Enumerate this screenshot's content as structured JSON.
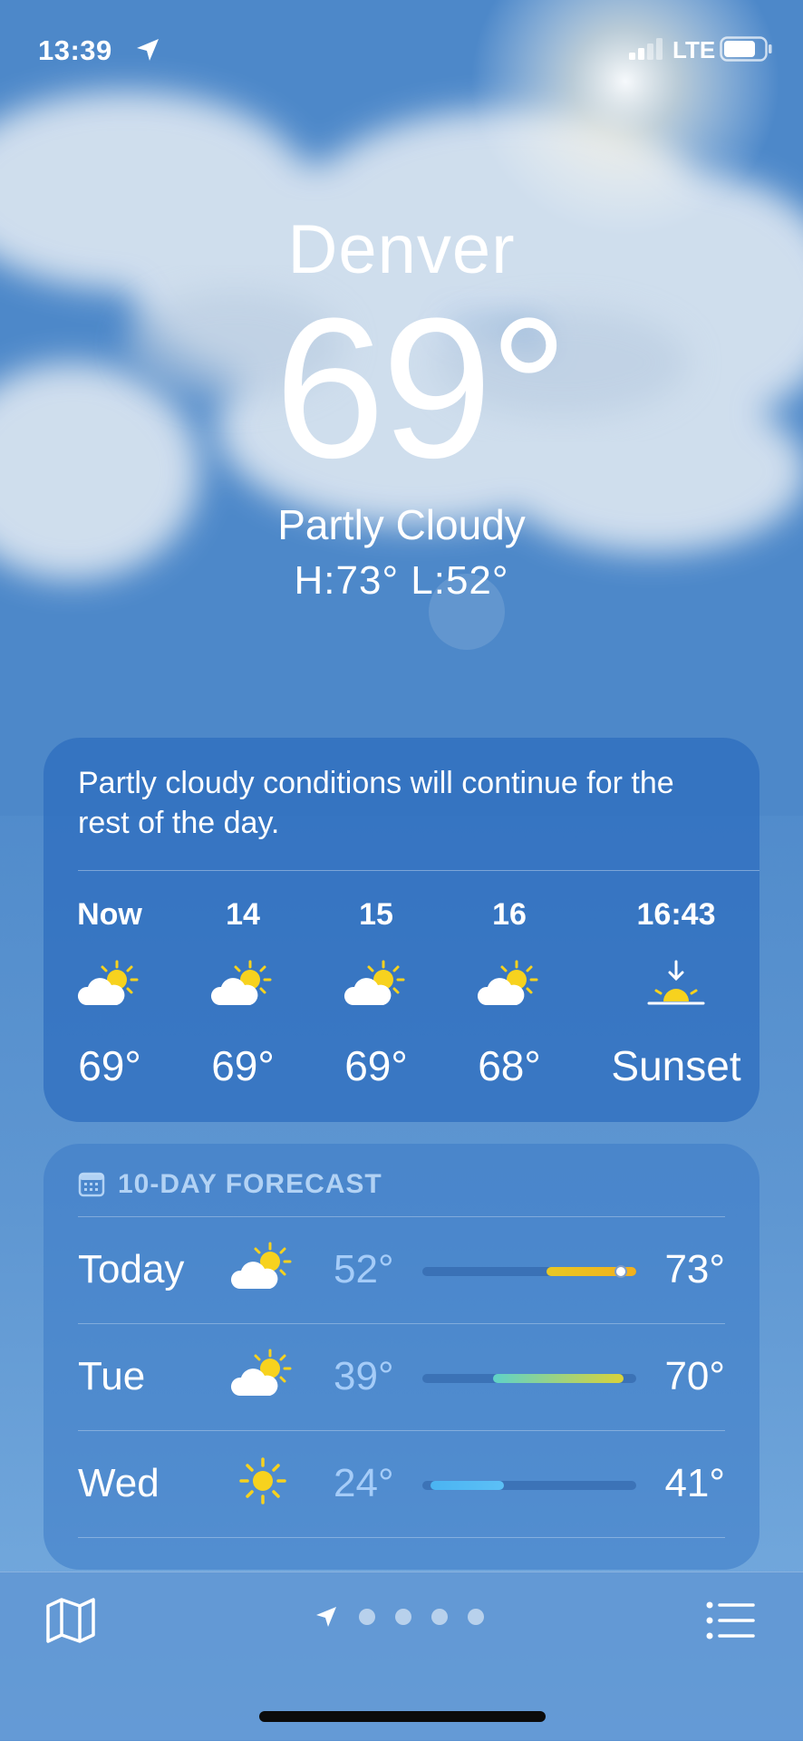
{
  "status_bar": {
    "time": "13:39",
    "network": "LTE"
  },
  "hero": {
    "city": "Denver",
    "temperature": "69°",
    "condition": "Partly Cloudy",
    "high_low": "H:73°  L:52°"
  },
  "hourly_card": {
    "summary": "Partly cloudy conditions will continue for the rest of the day.",
    "hours": [
      {
        "label": "Now",
        "icon": "partly-cloudy-icon",
        "temp": "69°"
      },
      {
        "label": "14",
        "icon": "partly-cloudy-icon",
        "temp": "69°"
      },
      {
        "label": "15",
        "icon": "partly-cloudy-icon",
        "temp": "69°"
      },
      {
        "label": "16",
        "icon": "partly-cloudy-icon",
        "temp": "68°"
      },
      {
        "label": "16:43",
        "icon": "sunset-icon",
        "temp": "Sunset"
      }
    ]
  },
  "forecast_card": {
    "header": "10-DAY FORECAST",
    "days": [
      {
        "day": "Today",
        "icon": "partly-cloudy-icon",
        "low": "52°",
        "high": "73°",
        "range_start": 0.58,
        "range_end": 1.0,
        "colors": [
          "#e8c824",
          "#f2b01c"
        ],
        "current_marker": 0.93
      },
      {
        "day": "Tue",
        "icon": "partly-cloudy-icon",
        "low": "39°",
        "high": "70°",
        "range_start": 0.33,
        "range_end": 0.94,
        "colors": [
          "#5fd2c8",
          "#d9d23a"
        ]
      },
      {
        "day": "Wed",
        "icon": "sun-icon",
        "low": "24°",
        "high": "41°",
        "range_start": 0.04,
        "range_end": 0.38,
        "colors": [
          "#4ab4f2",
          "#5cc0f6"
        ]
      }
    ]
  },
  "toolbar": {
    "page_dots": 4
  },
  "colors": {
    "sun_yellow": "#f7d21e",
    "cloud_white": "#ffffff"
  }
}
